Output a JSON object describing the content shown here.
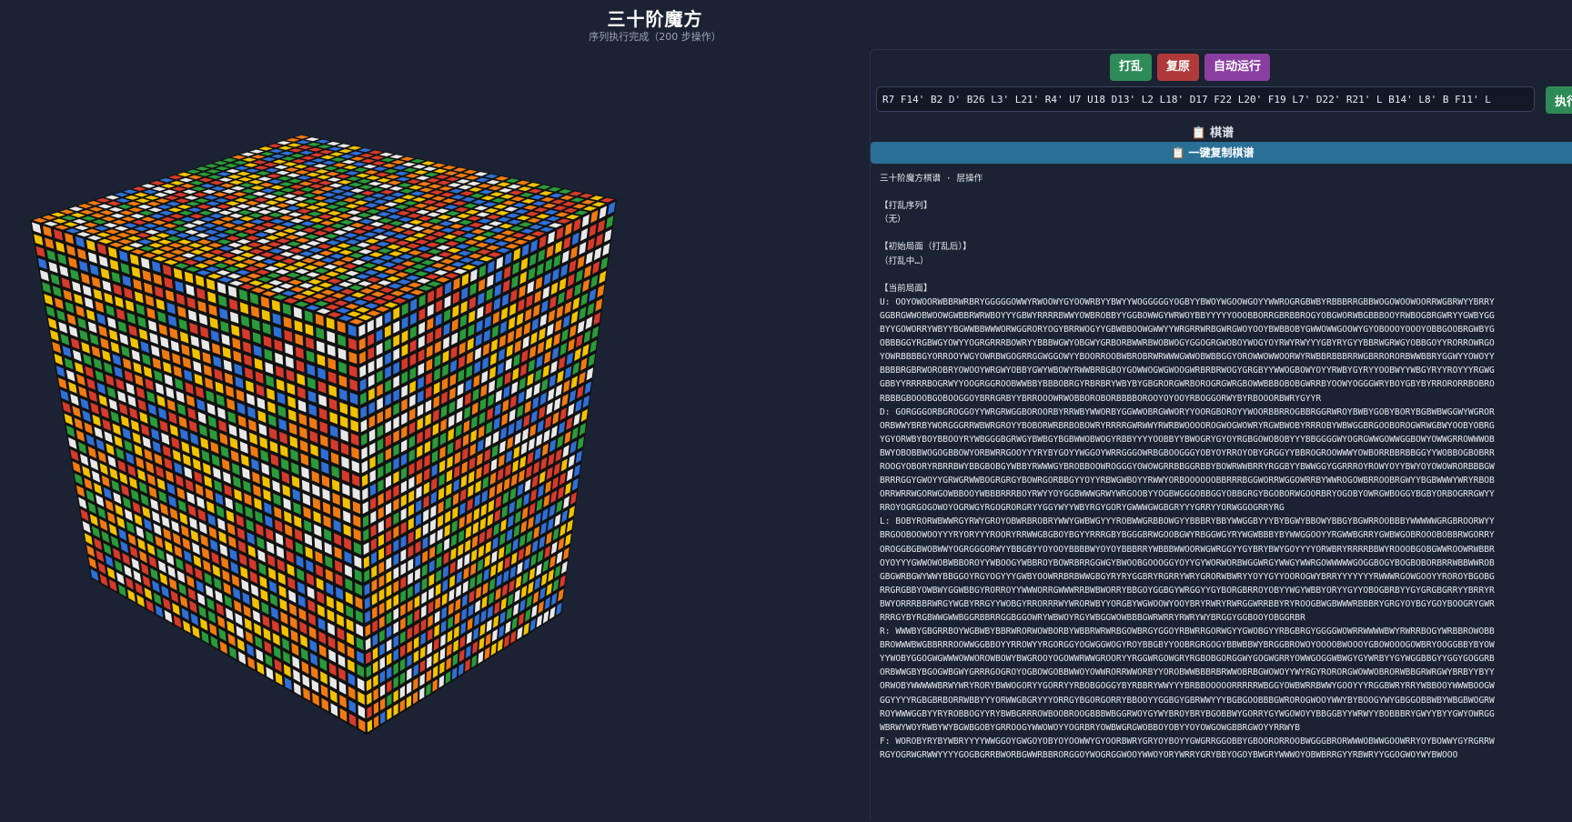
{
  "header": {
    "title": "三十阶魔方",
    "subtitle": "序列执行完成（200 步操作）"
  },
  "controls": {
    "scramble_label": "打乱",
    "reset_label": "复原",
    "auto_run_label": "自动运行",
    "sequence_value": "R7 F14' B2 D' B26 L3' L21' R4' U7 U18 D13' L2 L18' D17 F22 L20' F19 L7' D22' R21' L B14' L8' B F11' L",
    "execute_label": "执行"
  },
  "record_panel": {
    "title": "棋谱",
    "title_icon": "clipboard-icon",
    "copy_label": "一键复制棋谱",
    "copy_icon": "clipboard-icon",
    "header_line": "三十阶魔方棋谱 · 层操作",
    "scramble_heading": "【打乱序列】",
    "scramble_value": "（无）",
    "initial_heading": "【初始局面（打乱后）】",
    "initial_value": "（打乱中…）",
    "current_heading": "【当前局面】",
    "faces": [
      {
        "key": "U",
        "text": "U: OOYOWOORWBBRWRBRYGGGGGOWWYRWOOWYGYOOWRBYYBWYYWOGGGGGYOGBYYBWOYWGOOWGOYYWWROGRGBWBYRBBBRRGBBWOGOWOOWOORRWGBRWYYBRRYGGBRGWWOBWOOWGWBBRWRWBOYYYGBWYRRRRBWWYOWBROBBYYGGBOWWGYWRWOYBBYYYYYOOOBBORRGBRBBROGYOBGWORWBGBBBOOYRWBOGBRGWRYYGWBYGGBYYGOWORRYWBYYBGWWBBWWWORWGGRORYOGYBRRWOGYYGBWBBOOWGWWYYWRGRRWRBGWRGWOYOOYBWBBOBYGWWOWWGOOWYGYOBOOOYOOOYOBBGOOBRGWBYGOBBBGGYRGBWGYOWYYOGRGRRRBOWRYYBBBWGWYOBGWYGRBORBWWRBWOBWOGYGGOGRGWOBOYWOGYOYRWYRWYYYGBYRYGYYBBRWGRWGYOBBGOYYRORROWRGOYOWRBBBBGYORROOYWGYOWRBWGOGRRGGWGGOWYYBOORROOBWBROBRWRWWWGWWOBWBBGGYOROWWOWWOORWYRWBBRBBBRRWGBRRORORBWWBBRYGGWYYOWOYYBBBBRGBRWOROBRYOWOOYWRGWYOBBYGWYWBOWYRWWBRBGBOYGOWWOGWGWOOGWRBRBRWOGYGRGBYYWWOGBOWYOYYRWBYGYRYYOOBWYYWBGYRYYROYYYRGWGGBBYYRRRRBOGRWYYOOGRGGROOBWWBBYBBBOBRGYRBRBRYWBYBYGBGRORGWRBOROGRGWRGBOWWBBBOBOBGWRRBYOOWYOGGGWRYBOYGBYBYRRORORRBOBRORBBBGBOOOBGOBOOGGOYBRRGRBYYBRROOOWRWOBBOROBORBBBBOROOYOYOOYRBOGGORWYBYRBOOORBWRYGYYR"
      },
      {
        "key": "D",
        "text": "D: GORGGGORBGROGGOYYWRGRWGGBOROORBYRRWBYWWORBYGGWWOBRGWWORYYOORGBOROYYWOORBBRROGBBRGGRWROYBWBYGOBYBORYBGBWBWGGWYWGRORORBWWYBRBYWORGGGRRWBWRGROYYBOBORWRBRBOBOWRYRRRRGWRWWYRWRBWOOOOROGWOGWOWRYRGWBWOBYRRROBYWBWGGBRGOOBOROGWRWGBWYOOBYOBRGYGYORWBYBOYBBOOYRYWBGGGBGRWGYBWBGYBGBWWOBWOGYRBBYYYYOOBBYYBWOGRYGYOYRGBGOWOBOBYYYBBGGGGWYOGRGWWGOWWGGBOWYOWWGRROWWWOBBWYOBOBBWOGOGBBOWYORBWRRGOOYYYRYBYGOYYWGGOYWRRGGGOWRBGBOOGGGYOBYOYRROYOBYGRGGYYBBROGROOWWWYOWBORRBBRBBGGYYWOBBOGBOBRRROOGYOBORYRBRRBWYBBGBOBGYWBBYRWWWGYBROBBOOWROGGGYOWOWGRRBBGGRBBYBOWRWWBRRYRGGBYYBWWGGYGGRRROYROWYOYYBWYOYOWOWRORBBBGWBRRRGGYGWOYYGRWGRWWBOGRGRGYBOWRGORBBGYYOYYRBWGWBOYYRWWYORBOOOOOOBBRRRBGGWORRWGGOWRRBYWWROGOWBRROOBRGWYYBGBWWWYWRYRBOBORRWRRWGORWGOWBBOOYWBBBRRRBOYRWYYOYGGBWWWGRWYWRGOOBYYOGBWGGGOBBGGYOBBGRGYBGOBORWGOORBRYOGOBYOWRGWBOGGYBGBYORBOGRRGWYYRROYOGRGOGOWOYOGRWGYRGOGRORGRYYGGYWYYWBYRGYGORYGWWWGWGBGRYYYGRRYYORWGGOGRRYRG"
      },
      {
        "key": "L",
        "text": "L: BOBYRORWBWWRGYRWYGROYOBWRBROBRYWWYGWBWGYYYROBWWGRBBOWGYYBBBRYBBYWWGGBYYYBYBGWYBBOWYBBGYBGWRROOBBBYWWWWWGRGBROORWYYBRGOOBOOWOOYYYRYORYYYROORYRRWWGBGBOYBGYYRRRGBYBGGGBRWGOOBGWYRBGGWGYRYWGWBBBYBYWWGGOOYYRGWWBGRRYGWBWGOBROOOBOBBRWGORRYOROGGBGBWOBWWYOGRGGGORWYYBBGBYYOYOOYBBBBWYOYOYBBBRRYWBBBWWOORWGWRGGYYGYBRYBWYGOYYYYORWBRYRRRRBBWYROOOBGOBGWWROOWRWBBROYOYYYGWWOWOBWBBOROYYWBOOGYWBBROYBOWRBRRGGWGYBWOOBGOOOGGYOYYGYWORWORBWGGWRGYWWGYWWRGOWWWWWGOGGBOGYBOGBOBORBRRWBBWWROBGBGWRBGWYWWYBBGGOYRGYOGYYYGWBYOOWRRBRBWWGBGYRYRYGGBRYRGRRYWRYGRORWBWRYYOYYGYYOOROGWYBRRYYYYYYYRWWWRGOWGOOYYROROYBGOBGRRGRGBBYOWBWYGGWBBGYRORROYYWWWORRGWWWRRBWBWORRYBBGOYGGBGYWRGGYYGYBORGBRROYOBYYWGYWBBYORYYGYYOBOGBRBYYGYGRGBGRRYYBRRYRBWYORRRBBRWRGYWGBYRRGYYWOBGYRRORRRWYWRORWBYYORGBYWGWOOWYOOYBRYRWRYRWRGGWRRBBYRYROOGBWGBWWWRBBBRYGRGYOYBGYGOYBOOGRYGWRRRRGYBYRGBWWGWWBGGRBBRRGGBGGOWRYWBWOYRGYWBGGWOWBBBGWRWRRYRWRYWYBRGGYGGBOOYOBGGRBR"
      },
      {
        "key": "R",
        "text": "R: WWWBYGBGRRBOYWGBWBYBBRWRORWOWBORBYWBBRWRWRBGOWBRGYGGOYRBWRRGORWGYYGWOBGYYRBGBRGYGGGGWOWRRWWWWBWYRWRRBOGYWRBBROWOBBBROWWWBWGBBRRROOWWGGBBOYYRROWYYRGORGGYOGWGGWOGYROYBBGBYYOOBRGRGOGYBBWBBWYBRGGBROWOYOOOOBWOOOYGBOWOOOGOWBRYOOGGBBYBYOWYYWOBYGGOGWGWWWOWWOROWBOWYBWGROOYOGOWWRWWGROORYYRGGWRGOWGRYRGBOBGORGGWYGOGWGRRYOWWGOGGWBWGYGYWRBYYGYWGGBBGYYGGYGOGGRBORBWWGBYBGOGWBGWYGRRRGOGROYOGBOWGOBBWWOYOWWRORRWWORBYYOROBWWBBBRBRWWOBRBGWOWOYYWYRGYRORORGWOWWOBRORWBBGRWRGWYBRBYYBYYORWOBYWWWWWBRWYWRYRORYBWWOGORYYGORRYYRBOBGOGGYBYRBBRYWWYYYBRBBOOOOORRRRRWBGGYOWBWRRBWWYGOOYYYRGGBWRYRRYWBBOOYWWWBOOGWGGYYYYRGBGBRBORRWBBYYYORWWGBGRYYYORRGYBGORGORRYBBOOYYGGBGYGBRWWYYYBGBGOOBBBGWROROGWOOYWWYBYBOOGYWYGBGGOBBWBYWBGBWOGRWROYWWWGGBYYRYROBBOGYYRYBWBGRRROWBOOBROOGBBBWBGGRWOYGYWYBROYBRYBGOBBWYGORRYGYWGOWOYYBBGGBYYWRWYYBOBBBRYGWYYBYYGWYOWRGGWBRWYWOYRWBYWYBGWBGOBYGRROOGYWWOWOYYOGRBRYOWBWGRGWOBBOYOBYYOYOWGOWGBBRGWOYYRRWYB"
      },
      {
        "key": "F",
        "text": "F: WOROBYRYBYWBRYYYYWWGGOYGWGOYOBYOYOOWWYGYOORBWRYGRYOYBOYYGWGRRGGOBBYGBOORORROOBWGGGBRORWWWOBWWGOOWRRYOYBOWWYGYRGRRWRGYOGRWGRWWYYYYGOGBGRRBWORBGWWRBBRORGGOYWOGRGGWOOYWWOYORYWRRYGRYBBYOGOYBWGRYWWWOYOBWBRRGYYRBWRYYGGOGWOYWYBWOOO"
      }
    ]
  }
}
